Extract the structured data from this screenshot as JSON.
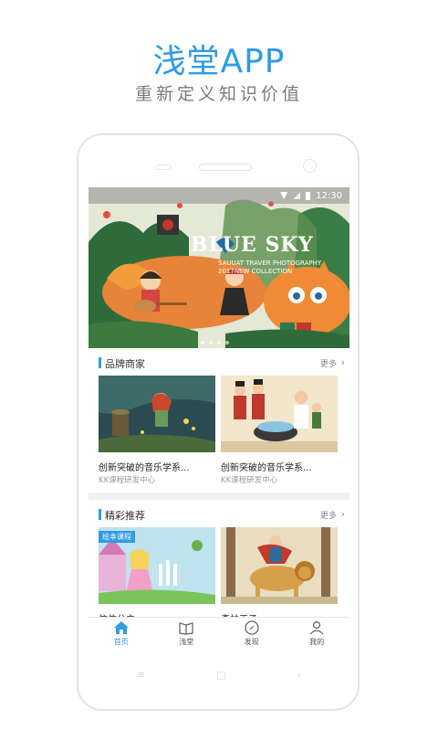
{
  "promo": {
    "title": "浅堂APP",
    "subtitle": "重新定义知识价值"
  },
  "status_bar": {
    "time": "12:30"
  },
  "banner": {
    "title": "BLUE SKY",
    "subtitle_line1": "SAUUAT TRAVER PHOTOGRAPHY",
    "subtitle_line2": "2017NEW COLLECTION",
    "dot_count": 4,
    "active_dot": 1
  },
  "sections": [
    {
      "title": "品牌商家",
      "more": "更多",
      "cards": [
        {
          "title": "创新突破的音乐学系...",
          "subtitle": "KK课程研发中心"
        },
        {
          "title": "创新突破的音乐学系...",
          "subtitle": "KK课程研发中心"
        }
      ]
    },
    {
      "title": "精彩推荐",
      "more": "更多",
      "cards": [
        {
          "tag": "绘本课程",
          "title": "依依公主"
        },
        {
          "title": "森林王子"
        }
      ]
    }
  ],
  "tabs": [
    {
      "label": "首页",
      "icon": "home-icon",
      "active": true
    },
    {
      "label": "浅堂",
      "icon": "book-icon",
      "active": false
    },
    {
      "label": "发现",
      "icon": "compass-icon",
      "active": false
    },
    {
      "label": "我的",
      "icon": "user-icon",
      "active": false
    }
  ],
  "colors": {
    "accent": "#2f9be5",
    "subtitle": "#7c7c7c"
  }
}
